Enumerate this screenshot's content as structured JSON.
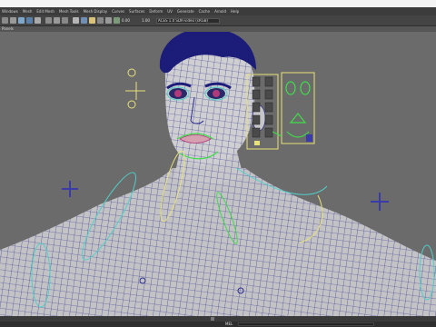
{
  "menu": {
    "items": [
      "Windows",
      "Mesh",
      "Edit Mesh",
      "Mesh Tools",
      "Mesh Display",
      "Curves",
      "Surfaces",
      "Deform",
      "UV",
      "Generate",
      "Cache",
      "Arnold",
      "Help"
    ]
  },
  "toolbar": {
    "value_1": "0.00",
    "value_2": "1.00",
    "colorspace": "ACES 1.0 SDR-video (sRGB)"
  },
  "panel": {
    "label": "Panels"
  },
  "command_line": {
    "label": "MEL"
  },
  "colors": {
    "viewport_bg": "#6b6b6b",
    "wireframe": "#26268a",
    "control_yellow": "#e8e27a",
    "control_cyan": "#4fd0c8",
    "control_green": "#3fdc4a",
    "locator_blue": "#3a3aa8"
  },
  "icons": [
    "select-icon",
    "lasso-icon",
    "paint-icon",
    "move-icon",
    "rotate-icon",
    "scale-icon",
    "camera-icon",
    "grid-icon",
    "shading-icon",
    "wireframe-icon",
    "lighting-icon",
    "shadow-icon",
    "xray-icon",
    "isolate-icon"
  ]
}
